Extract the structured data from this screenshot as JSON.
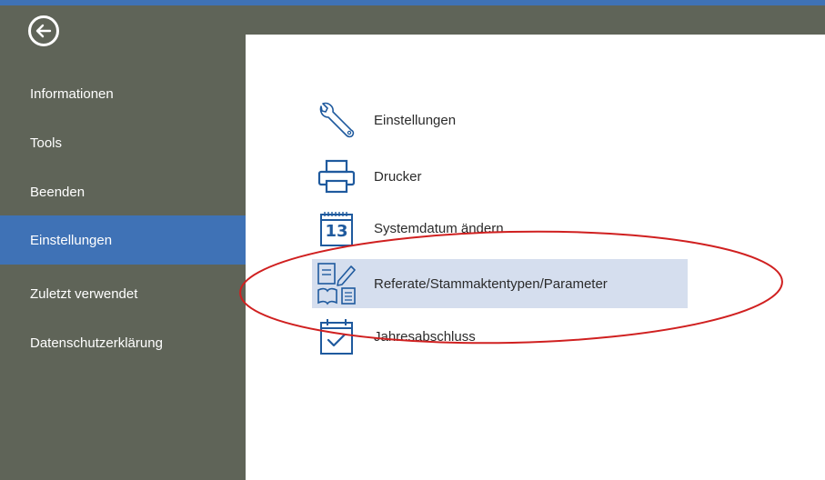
{
  "colors": {
    "sidebar_bg": "#5f6458",
    "accent": "#3f72b6",
    "content_bg": "#ffffff",
    "highlight_bg": "#d5deee",
    "annotation_red": "#d02020",
    "icon_blue": "#1f5a9e"
  },
  "back_button": {
    "icon": "arrow-left-icon"
  },
  "sidebar": {
    "items": [
      {
        "label": "Informationen",
        "active": false
      },
      {
        "label": "Tools",
        "active": false
      },
      {
        "label": "Beenden",
        "active": false
      },
      {
        "label": "Einstellungen",
        "active": true
      },
      {
        "label": "Zuletzt verwendet",
        "active": false
      },
      {
        "label": "Datenschutzerklärung",
        "active": false
      }
    ]
  },
  "main": {
    "items": [
      {
        "label": "Einstellungen",
        "icon": "wrench-icon",
        "highlighted": false
      },
      {
        "label": "Drucker",
        "icon": "printer-icon",
        "highlighted": false
      },
      {
        "label": "Systemdatum ändern",
        "icon": "calendar-icon",
        "calendar_day": "13",
        "highlighted": false
      },
      {
        "label": "Referate/Stammaktentypen/Parameter",
        "icon": "documents-edit-icon",
        "highlighted": true
      },
      {
        "label": "Jahresabschluss",
        "icon": "calendar-check-icon",
        "highlighted": false
      }
    ]
  }
}
